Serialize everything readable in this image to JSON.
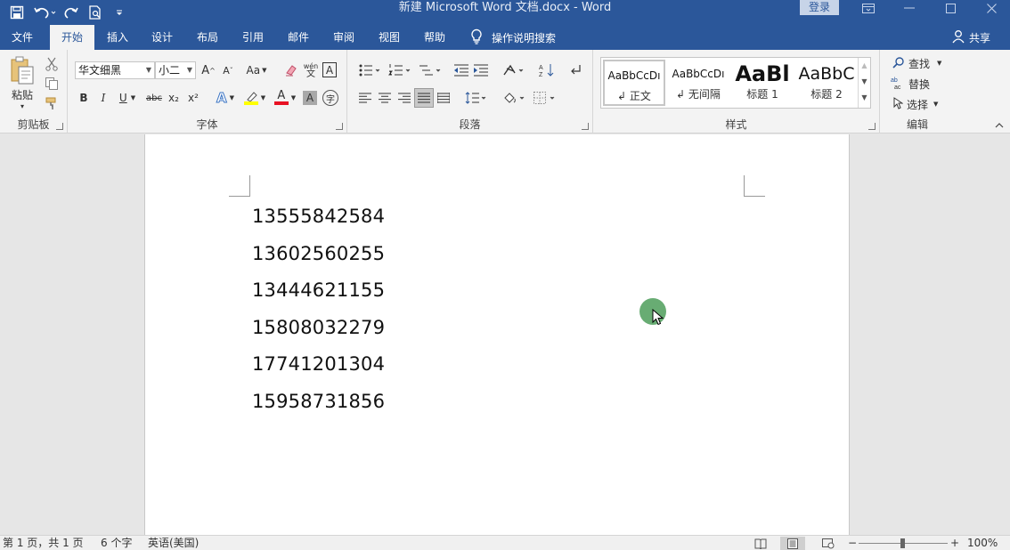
{
  "titlebar": {
    "title": "新建 Microsoft Word 文档.docx  -  Word",
    "login": "登录",
    "qat_icons": [
      "save-icon",
      "undo-icon",
      "redo-icon",
      "print-preview-icon",
      "customize-icon"
    ]
  },
  "tabs": [
    {
      "label": "文件",
      "active": false
    },
    {
      "label": "开始",
      "active": true
    },
    {
      "label": "插入",
      "active": false
    },
    {
      "label": "设计",
      "active": false
    },
    {
      "label": "布局",
      "active": false
    },
    {
      "label": "引用",
      "active": false
    },
    {
      "label": "邮件",
      "active": false
    },
    {
      "label": "审阅",
      "active": false
    },
    {
      "label": "视图",
      "active": false
    },
    {
      "label": "帮助",
      "active": false
    }
  ],
  "tellme": {
    "label": "操作说明搜索"
  },
  "share": {
    "label": "共享"
  },
  "ribbon": {
    "clipboard": {
      "label": "剪贴板",
      "paste_label": "粘贴"
    },
    "font": {
      "label": "字体",
      "font_name": "华文细黑",
      "font_size": "小二",
      "bold": "B",
      "italic": "I",
      "underline": "U",
      "strike": "abc",
      "subscript": "x₂",
      "superscript": "x²",
      "grow": "A",
      "shrink": "A",
      "case": "Aa",
      "phonetic": "wén",
      "border_char": "A",
      "effects": "A",
      "highlight_color": "#ffff00",
      "font_color": "#e81123",
      "shade": "A",
      "enclose": "字"
    },
    "paragraph": {
      "label": "段落"
    },
    "styles": {
      "label": "样式",
      "items": [
        {
          "preview": "AaBbCcDı",
          "name": "正文",
          "name_prefix": "↲ "
        },
        {
          "preview": "AaBbCcDı",
          "name": "无间隔",
          "name_prefix": "↲ "
        },
        {
          "preview": "AaBl",
          "name": "标题 1",
          "name_prefix": ""
        },
        {
          "preview": "AaBbC",
          "name": "标题 2",
          "name_prefix": ""
        }
      ]
    },
    "editing": {
      "label": "编辑",
      "find": "查找",
      "replace": "替换",
      "select": "选择"
    }
  },
  "document": {
    "lines": [
      "13555842584",
      "13602560255",
      "13444621155",
      "15808032279",
      "17741201304",
      "15958731856"
    ]
  },
  "statusbar": {
    "page": "第 1 页，共 1 页",
    "words": "6 个字",
    "language": "英语(美国)",
    "zoom_minus": "−",
    "zoom_plus": "+",
    "zoom": "100%"
  }
}
